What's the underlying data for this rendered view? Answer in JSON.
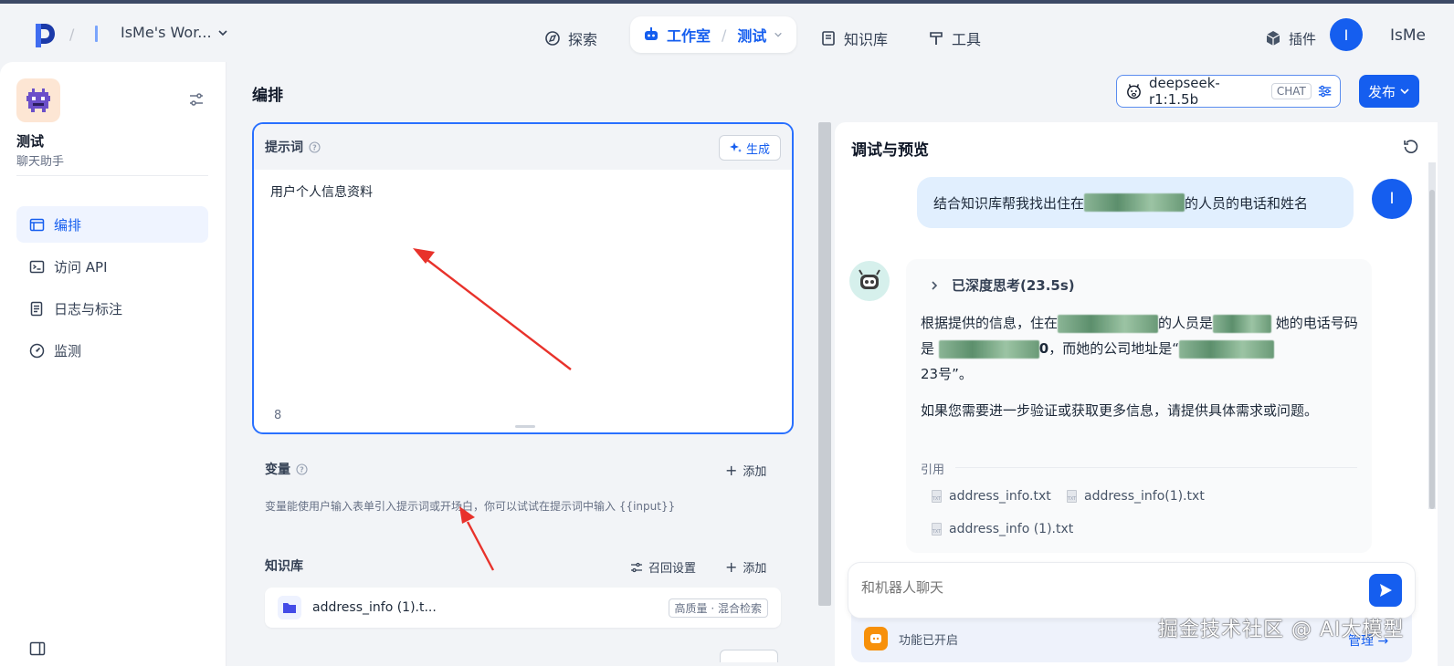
{
  "topbar": {
    "workspace_name": "IsMe's Wor...",
    "nav_explore": "探索",
    "nav_studio": "工作室",
    "nav_studio_app": "测试",
    "nav_knowledge": "知识库",
    "nav_tools": "工具",
    "plugins": "插件",
    "user_initial": "I",
    "user_name": "IsMe"
  },
  "sidebar": {
    "app_name": "测试",
    "app_type": "聊天助手",
    "items": [
      {
        "label": "编排",
        "icon": "layout-icon",
        "active": true
      },
      {
        "label": "访问 API",
        "icon": "terminal-icon",
        "active": false
      },
      {
        "label": "日志与标注",
        "icon": "log-icon",
        "active": false
      },
      {
        "label": "监测",
        "icon": "gauge-icon",
        "active": false
      }
    ]
  },
  "editor": {
    "title": "编排",
    "model_name": "deepseek-r1:1.5b",
    "model_badge": "CHAT",
    "publish_label": "发布",
    "prompt": {
      "title": "提示词",
      "generate_label": "生成",
      "text": "用户个人信息资料",
      "char_count": "8"
    },
    "variables": {
      "title": "变量",
      "add_label": "添加",
      "description": "变量能使用户输入表单引入提示词或开场白，你可以试试在提示词中输入 {{input}}"
    },
    "knowledge": {
      "title": "知识库",
      "recall_label": "召回设置",
      "add_label": "添加",
      "item_name": "address_info (1).t...",
      "item_tag": "高质量 · 混合检索"
    }
  },
  "preview": {
    "title": "调试与预览",
    "user_msg_prefix": "结合知识库帮我找出住在",
    "user_msg_suffix": "的人员的电话和姓名",
    "user_initial": "I",
    "thinking_label": "已深度思考(23.5s)",
    "reply_p1_a": "根据提供的信息，住在",
    "reply_p1_b": "的人员是",
    "reply_p1_c": " 她的电话号码是 ",
    "reply_p1_d": "0",
    "reply_p1_e": "，而她的公司地址是“",
    "reply_p1_f": "23号”。",
    "reply_p2": "如果您需要进一步验证或获取更多信息，请提供具体需求或问题。",
    "cite_label": "引用",
    "citations": [
      "address_info.txt",
      "address_info(1).txt",
      "address_info (1).txt"
    ],
    "input_placeholder": "和机器人聊天",
    "feature_label": "功能已开启",
    "manage_label": "管理"
  },
  "watermark": "掘金技术社区 @ AI大模型",
  "colors": {
    "accent": "#155eef",
    "annotation": "#e8322b"
  }
}
